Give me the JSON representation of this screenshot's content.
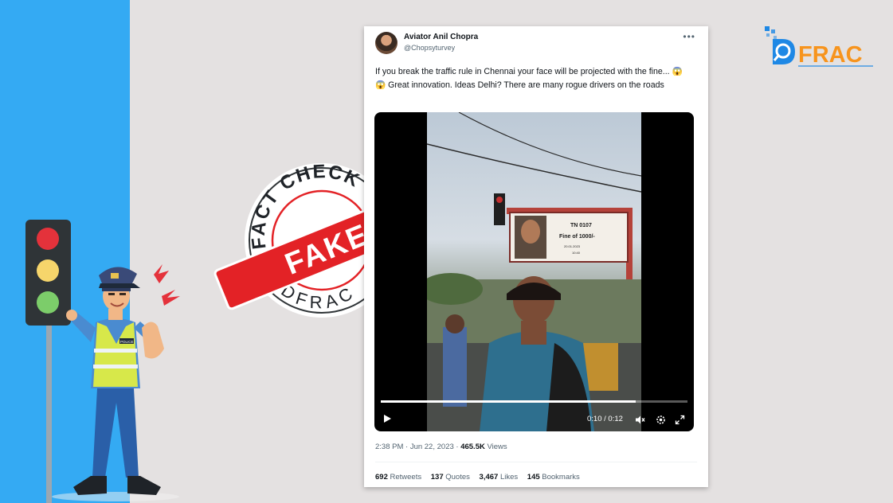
{
  "brand": {
    "logo_text": "FRAC",
    "stamp_top": "FACT CHECK",
    "stamp_bottom": "DFRAC",
    "stamp_label": "FAKE"
  },
  "tweet": {
    "author_name": "Aviator Anil Chopra",
    "author_handle": "@Chopsyturvey",
    "text": "If you break the traffic rule in Chennai your face will be projected with the fine... 😱😱 Great innovation. Ideas Delhi? There are many rogue drivers on the roads",
    "timestamp": "2:38 PM · Jun 22, 2023 · ",
    "views_count": "465.5K",
    "views_label": " Views",
    "stats": [
      {
        "count": "692",
        "label": "Retweets"
      },
      {
        "count": "137",
        "label": "Quotes"
      },
      {
        "count": "3,467",
        "label": "Likes"
      },
      {
        "count": "145",
        "label": "Bookmarks"
      }
    ]
  },
  "video": {
    "time": "0:10 / 0:12",
    "progress": 0.83,
    "billboard_line1": "TN 0107",
    "billboard_line2": "Fine of 1000/-",
    "billboard_line3": "20.01.2023",
    "billboard_line4": "10:40"
  },
  "illustration": {
    "vest_text": "POLICE"
  },
  "colors": {
    "left_panel": "#34aaf3",
    "background": "#e4e1e1",
    "stamp_red": "#e32226",
    "logo_orange": "#f7941d",
    "logo_blue": "#1e88e5"
  },
  "icons": [
    "more-icon",
    "play-icon",
    "volume-icon",
    "settings-icon",
    "fullscreen-icon"
  ]
}
